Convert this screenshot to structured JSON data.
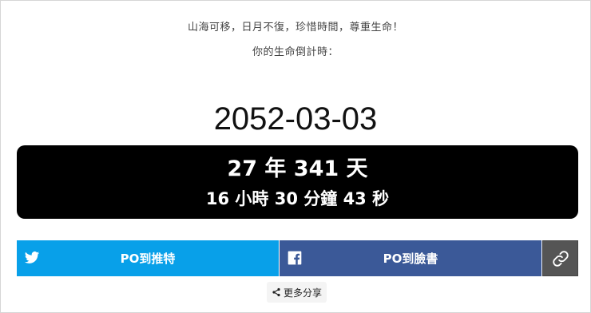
{
  "header": {
    "motto": "山海可移，日月不復，珍惜時間，尊重生命！",
    "subtitle": "你的生命倒計時："
  },
  "target_date": "2052-03-03",
  "countdown": {
    "line1": "27 年 341 天",
    "line2": "16 小時 30 分鐘 43 秒"
  },
  "share": {
    "twitter_label": "PO到推特",
    "facebook_label": "PO到臉書",
    "more_label": "更多分享",
    "icons": {
      "twitter": "twitter-icon",
      "facebook": "facebook-icon",
      "link": "link-icon",
      "more": "share-icon"
    }
  },
  "colors": {
    "twitter": "#08a0e9",
    "facebook": "#3b5998",
    "link": "#555555",
    "countdown_bg": "#000000"
  }
}
